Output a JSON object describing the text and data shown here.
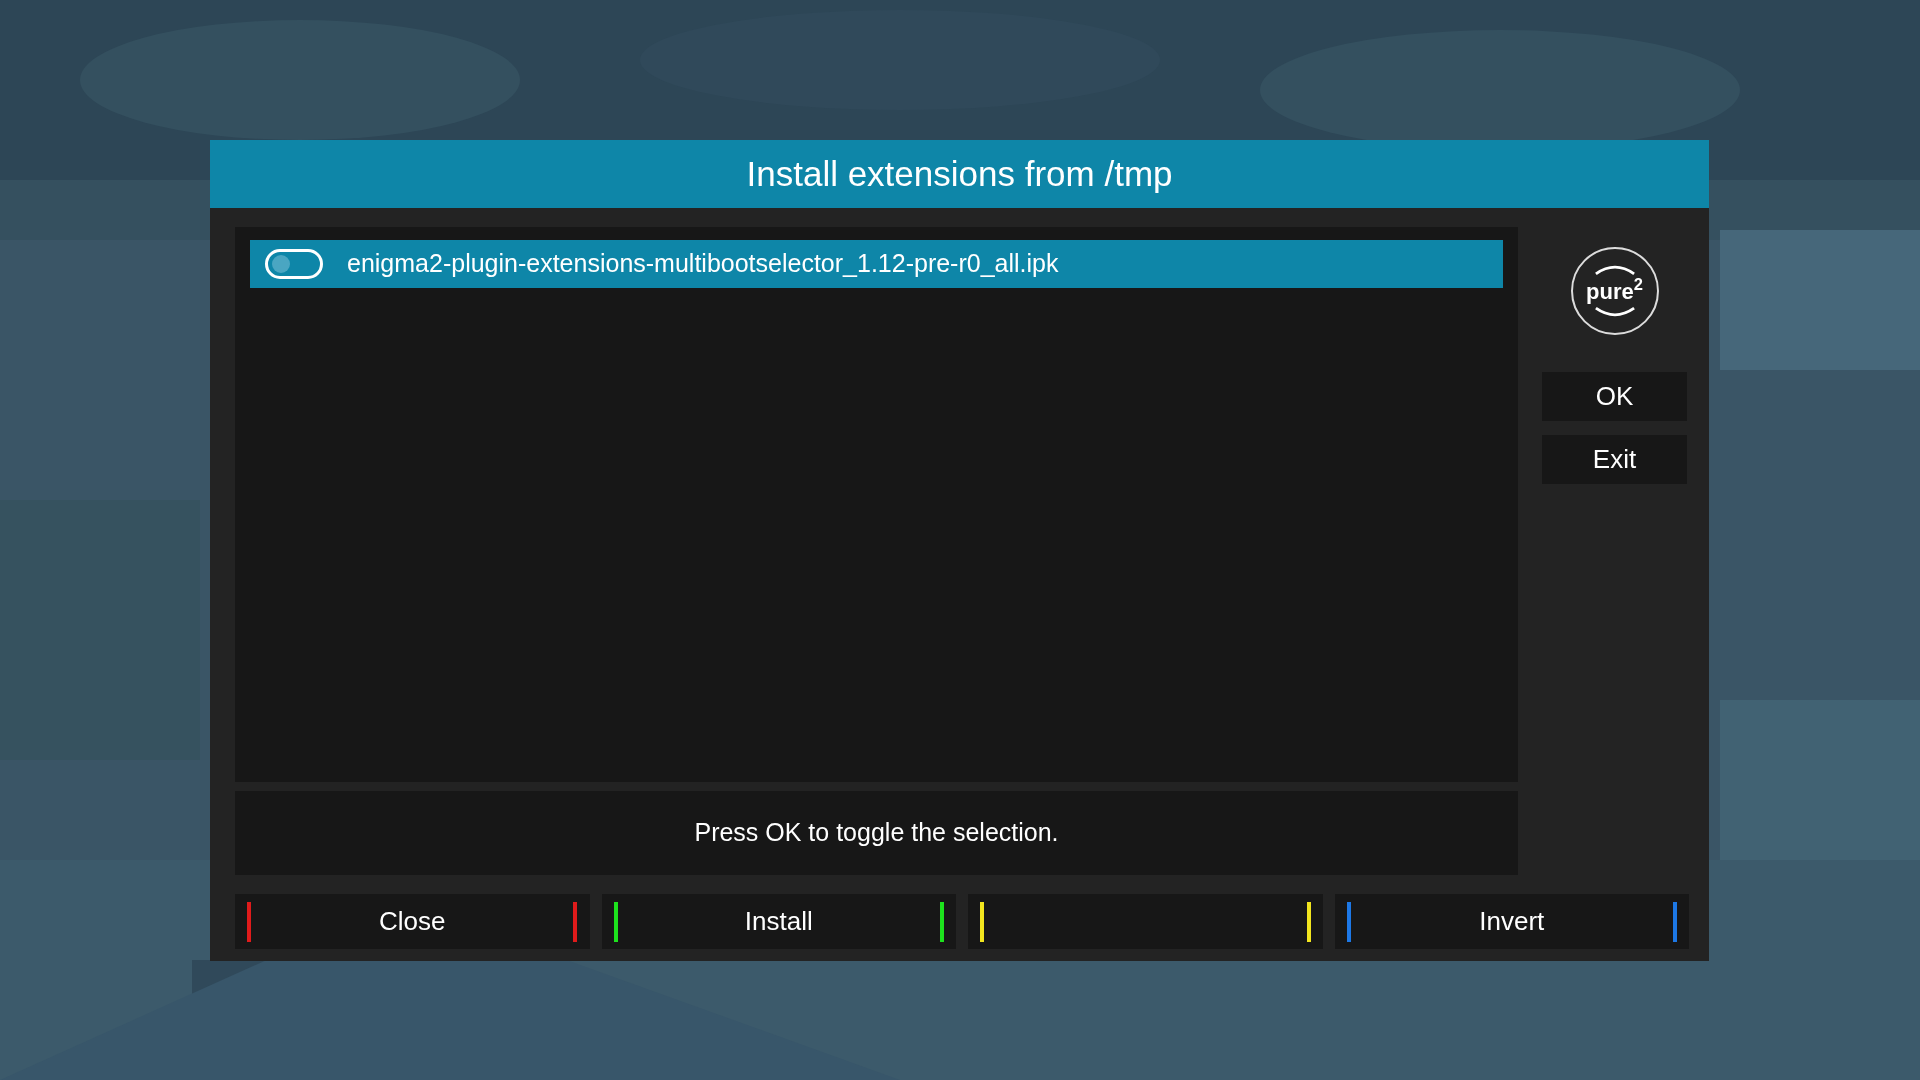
{
  "dialog": {
    "title": "Install extensions from /tmp",
    "list": [
      {
        "label": "enigma2-plugin-extensions-multibootselector_1.12-pre-r0_all.ipk",
        "checked": false,
        "selected": true
      }
    ],
    "hint": "Press OK to toggle the selection.",
    "logo": "pure$^{2}$",
    "side_buttons": [
      "OK",
      "Exit"
    ],
    "color_buttons": [
      {
        "label": "Close",
        "color": "#e01b1b"
      },
      {
        "label": "Install",
        "color": "#1de21d"
      },
      {
        "color": "#f2e51e"
      },
      {
        "label": "Invert",
        "color": "#1d78e6"
      }
    ]
  }
}
